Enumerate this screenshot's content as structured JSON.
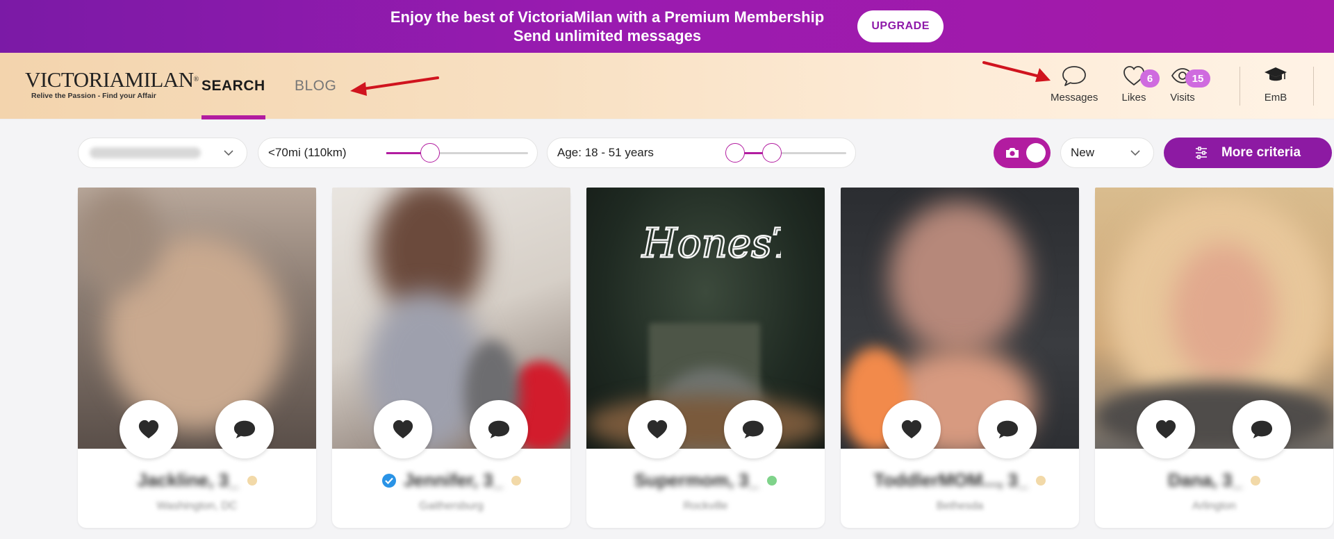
{
  "promo": {
    "line1": "Enjoy the best of VictoriaMilan with a Premium Membership",
    "line2": "Send unlimited messages",
    "upgrade_label": "UPGRADE"
  },
  "header": {
    "logo_text": "VICTORIAMILAN",
    "logo_tagline": "Relive the Passion - Find your Affair",
    "nav": {
      "search": "SEARCH",
      "blog": "BLOG"
    },
    "messages_label": "Messages",
    "likes_label": "Likes",
    "likes_count": "6",
    "visits_label": "Visits",
    "visits_count": "15",
    "profile_label": "EmB"
  },
  "filters": {
    "location_value": "Washington DC, D...",
    "distance_label": "<70mi (110km)",
    "distance_fraction": 0.31,
    "age_label": "Age: 18 - 51 years",
    "age_min_fraction": 0.0,
    "age_max_fraction": 0.33,
    "photo_toggle_on": true,
    "sort_value": "New",
    "more_label": "More criteria"
  },
  "colors": {
    "accent": "#b21ca0",
    "online": "#7fd38a",
    "away": "#f2d9a8",
    "verified": "#2a93e6"
  },
  "cards": [
    {
      "name": "Jackline, 3_",
      "location": "Washington, DC",
      "status": "away",
      "verified": false
    },
    {
      "name": "Jennifer, 3_",
      "location": "Gaithersburg",
      "status": "away",
      "verified": true
    },
    {
      "name": "Supermom, 3_",
      "location": "Rockville",
      "status": "online",
      "verified": false
    },
    {
      "name": "ToddlerMOM..., 3_",
      "location": "Bethesda",
      "status": "away",
      "verified": false
    },
    {
      "name": "Dana, 3_",
      "location": "Arlington",
      "status": "away",
      "verified": false
    }
  ]
}
